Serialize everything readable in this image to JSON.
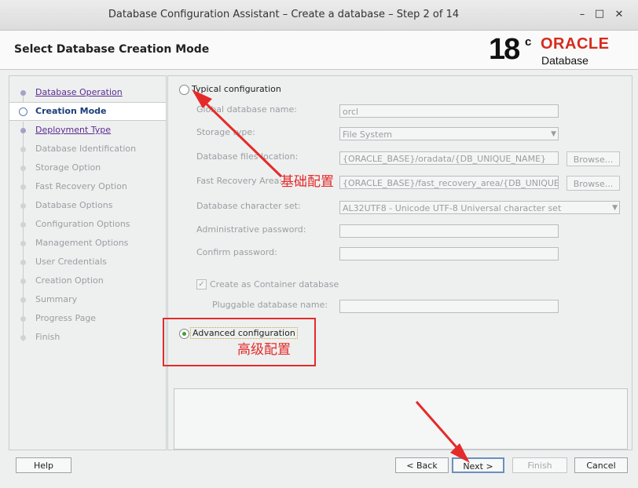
{
  "window": {
    "title": "Database Configuration Assistant – Create a database – Step 2 of 14",
    "minimize": "–",
    "maximize": "□",
    "close": "✕"
  },
  "header": {
    "title": "Select Database Creation Mode",
    "logo_version": "18",
    "logo_sup": "c",
    "logo_brand": "ORACLE",
    "logo_product": "Database"
  },
  "steps": [
    {
      "label": "Database Operation",
      "state": "link"
    },
    {
      "label": "Creation Mode",
      "state": "current"
    },
    {
      "label": "Deployment Type",
      "state": "link"
    },
    {
      "label": "Database Identification",
      "state": "disabled"
    },
    {
      "label": "Storage Option",
      "state": "disabled"
    },
    {
      "label": "Fast Recovery Option",
      "state": "disabled"
    },
    {
      "label": "Database Options",
      "state": "disabled"
    },
    {
      "label": "Configuration Options",
      "state": "disabled"
    },
    {
      "label": "Management Options",
      "state": "disabled"
    },
    {
      "label": "User Credentials",
      "state": "disabled"
    },
    {
      "label": "Creation Option",
      "state": "disabled"
    },
    {
      "label": "Summary",
      "state": "disabled"
    },
    {
      "label": "Progress Page",
      "state": "disabled"
    },
    {
      "label": "Finish",
      "state": "disabled"
    }
  ],
  "typical": {
    "label": "Typical configuration",
    "selected": false,
    "global_db_name_label": "Global database name:",
    "global_db_name_value": "orcl",
    "storage_type_label": "Storage type:",
    "storage_type_value": "File System",
    "db_files_location_label": "Database files location:",
    "db_files_location_value": "{ORACLE_BASE}/oradata/{DB_UNIQUE_NAME}",
    "fra_label": "Fast Recovery Area:",
    "fra_value": "{ORACLE_BASE}/fast_recovery_area/{DB_UNIQUE_NAME}",
    "browse_label": "Browse...",
    "charset_label": "Database character set:",
    "charset_value": "AL32UTF8 - Unicode UTF-8 Universal character set",
    "admin_pw_label": "Administrative password:",
    "admin_pw_value": "",
    "confirm_pw_label": "Confirm password:",
    "confirm_pw_value": "",
    "container_label": "Create as Container database",
    "container_checked": true,
    "pdb_name_label": "Pluggable database name:",
    "pdb_name_value": ""
  },
  "advanced": {
    "label": "Advanced configuration",
    "selected": true
  },
  "annotations": {
    "typical_note": "基础配置",
    "advanced_note": "高级配置",
    "color": "#e52a2a"
  },
  "footer": {
    "help": "Help",
    "back": "< Back",
    "next": "Next >",
    "finish": "Finish",
    "cancel": "Cancel"
  }
}
